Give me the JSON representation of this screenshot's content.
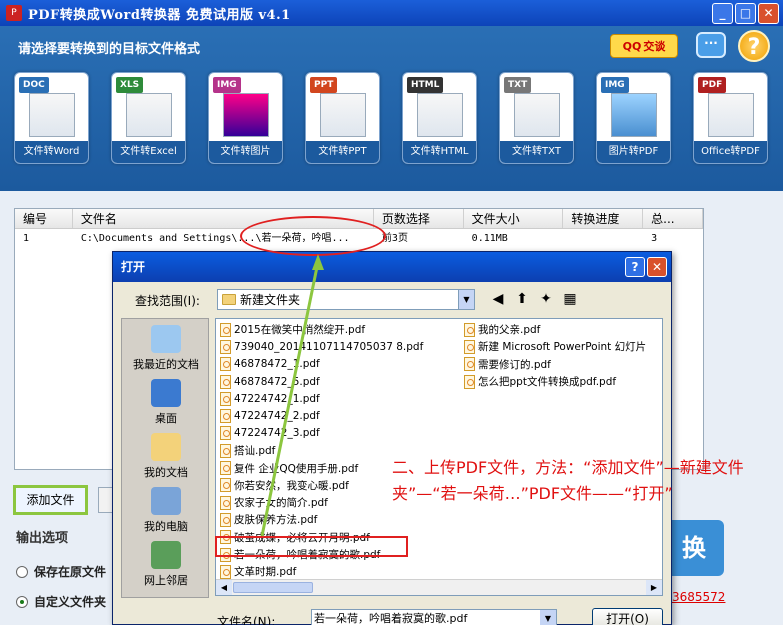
{
  "window": {
    "title": "PDF转换成Word转换器 免费试用版 v4.1",
    "min": "_",
    "max": "□",
    "close": "✕"
  },
  "header": {
    "prompt": "请选择要转换到的目标文件格式",
    "qq_label": "交谈",
    "chat_label": "···",
    "help_label": "?"
  },
  "formats": [
    {
      "tag": "DOC",
      "label": "文件转Word",
      "color": "#2a6fb5"
    },
    {
      "tag": "XLS",
      "label": "文件转Excel",
      "color": "#2e8b3a"
    },
    {
      "tag": "IMG",
      "label": "文件转图片",
      "color": "#b5338a"
    },
    {
      "tag": "PPT",
      "label": "文件转PPT",
      "color": "#d2461e"
    },
    {
      "tag": "HTML",
      "label": "文件转HTML",
      "color": "#333333"
    },
    {
      "tag": "TXT",
      "label": "文件转TXT",
      "color": "#777777"
    },
    {
      "tag": "IMG",
      "label": "图片转PDF",
      "color": "#2a6fb5"
    },
    {
      "tag": "PDF",
      "label": "Office转PDF",
      "color": "#b02020"
    }
  ],
  "list": {
    "headers": [
      "编号",
      "文件名",
      "页数选择",
      "文件大小",
      "转换进度",
      "总..."
    ],
    "rows": [
      {
        "num": "1",
        "name": "C:\\Documents and Settings\\...\\若一朵荷，吟唱...",
        "pages": "前3页",
        "size": "0.11MB",
        "progress": "",
        "total": "3"
      }
    ]
  },
  "controls": {
    "add_file": "添加文件",
    "output_title": "输出选项",
    "radio_original": "保存在原文件",
    "radio_custom": "自定义文件夹",
    "convert_label": "换",
    "phone": "3685572"
  },
  "dialog": {
    "title": "打开",
    "help": "?",
    "close": "✕",
    "lookin_label": "查找范围(I):",
    "lookin_value": "新建文件夹",
    "places": [
      "我最近的文档",
      "桌面",
      "我的文档",
      "我的电脑",
      "网上邻居"
    ],
    "files_left": [
      "2015在微笑中悄然绽开.pdf",
      "739040_20141107114705037 8.pdf",
      "46878472_1.pdf",
      "46878472_5.pdf",
      "47224742_1.pdf",
      "47224742_2.pdf",
      "47224742_3.pdf",
      "搭讪.pdf",
      "复件 企业QQ使用手册.pdf",
      "你若安然，我变心暖.pdf",
      "农家子女的简介.pdf",
      "皮肤保养方法.pdf",
      "破茧成蝶，必将云开月明.pdf",
      "若一朵荷，吟唱着寂寞的歌.pdf",
      "文革时期.pdf"
    ],
    "files_right": [
      "我的父亲.pdf",
      "新建 Microsoft PowerPoint 幻灯片",
      "需要修订的.pdf",
      "怎么把ppt文件转换成pdf.pdf"
    ],
    "filename_label": "文件名(N):",
    "filename_value": "若一朵荷，吟唱着寂寞的歌.pdf",
    "open_button": "打开(O)"
  },
  "annotation": {
    "text": "二、上传PDF文件，方法：“添加文件”—新建文件夹”—“若一朵荷…”PDF文件——“打开”"
  }
}
